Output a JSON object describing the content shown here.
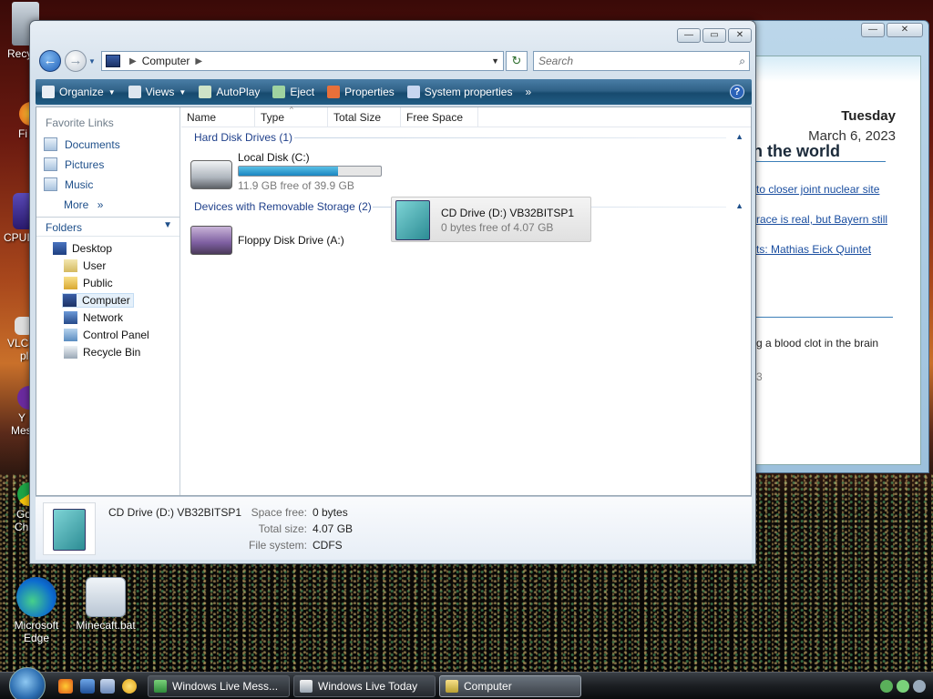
{
  "desktop": {
    "icons": [
      {
        "label": "Recy"
      },
      {
        "label": "Fi"
      },
      {
        "label": "CPUI"
      },
      {
        "label": "VLC"
      },
      {
        "label": "pl"
      },
      {
        "label": "Y"
      },
      {
        "label": "Mes"
      },
      {
        "label": "Go"
      },
      {
        "label": "Ch"
      },
      {
        "label": "Microsoft Edge"
      },
      {
        "label": "Minecaft.bat"
      }
    ]
  },
  "live_today": {
    "day": "Tuesday",
    "date": "March 6, 2023",
    "heading": "n the world",
    "links": [
      "to closer joint nuclear site",
      "race is real, but Bayern still",
      "ts: Mathias Eick Quintet"
    ],
    "text": "g a blood clot in the brain",
    "fragment": "3"
  },
  "explorer": {
    "address": {
      "root": "Computer"
    },
    "search_placeholder": "Search",
    "toolbar": {
      "organize": "Organize",
      "views": "Views",
      "autoplay": "AutoPlay",
      "eject": "Eject",
      "properties": "Properties",
      "system_properties": "System properties",
      "overflow": "»",
      "help": "?"
    },
    "sidebar": {
      "favorites_title": "Favorite Links",
      "favorites": [
        "Documents",
        "Pictures",
        "Music"
      ],
      "more": "More",
      "more_chevron": "»",
      "folders_title": "Folders",
      "tree": [
        "Desktop",
        "User",
        "Public",
        "Computer",
        "Network",
        "Control Panel",
        "Recycle Bin"
      ]
    },
    "columns": [
      "Name",
      "Type",
      "Total Size",
      "Free Space"
    ],
    "groups": {
      "hdd": {
        "title": "Hard Disk Drives (1)",
        "drives": [
          {
            "name": "Local Disk (C:)",
            "free": "11.9 GB free of 39.9 GB",
            "used_fraction": 0.7
          }
        ]
      },
      "removable": {
        "title": "Devices with Removable Storage (2)",
        "drives": [
          {
            "name": "Floppy Disk Drive (A:)"
          },
          {
            "name": "CD Drive (D:) VB32BITSP1",
            "free": "0 bytes free of 4.07 GB"
          }
        ]
      }
    },
    "details": {
      "name": "CD Drive (D:) VB32BITSP1",
      "space_free_label": "Space free:",
      "space_free": "0 bytes",
      "total_size_label": "Total size:",
      "total_size": "4.07 GB",
      "fs_label": "File system:",
      "fs": "CDFS"
    }
  },
  "taskbar": {
    "tasks": [
      "Windows Live Mess...",
      "Windows Live Today",
      "Computer"
    ]
  }
}
